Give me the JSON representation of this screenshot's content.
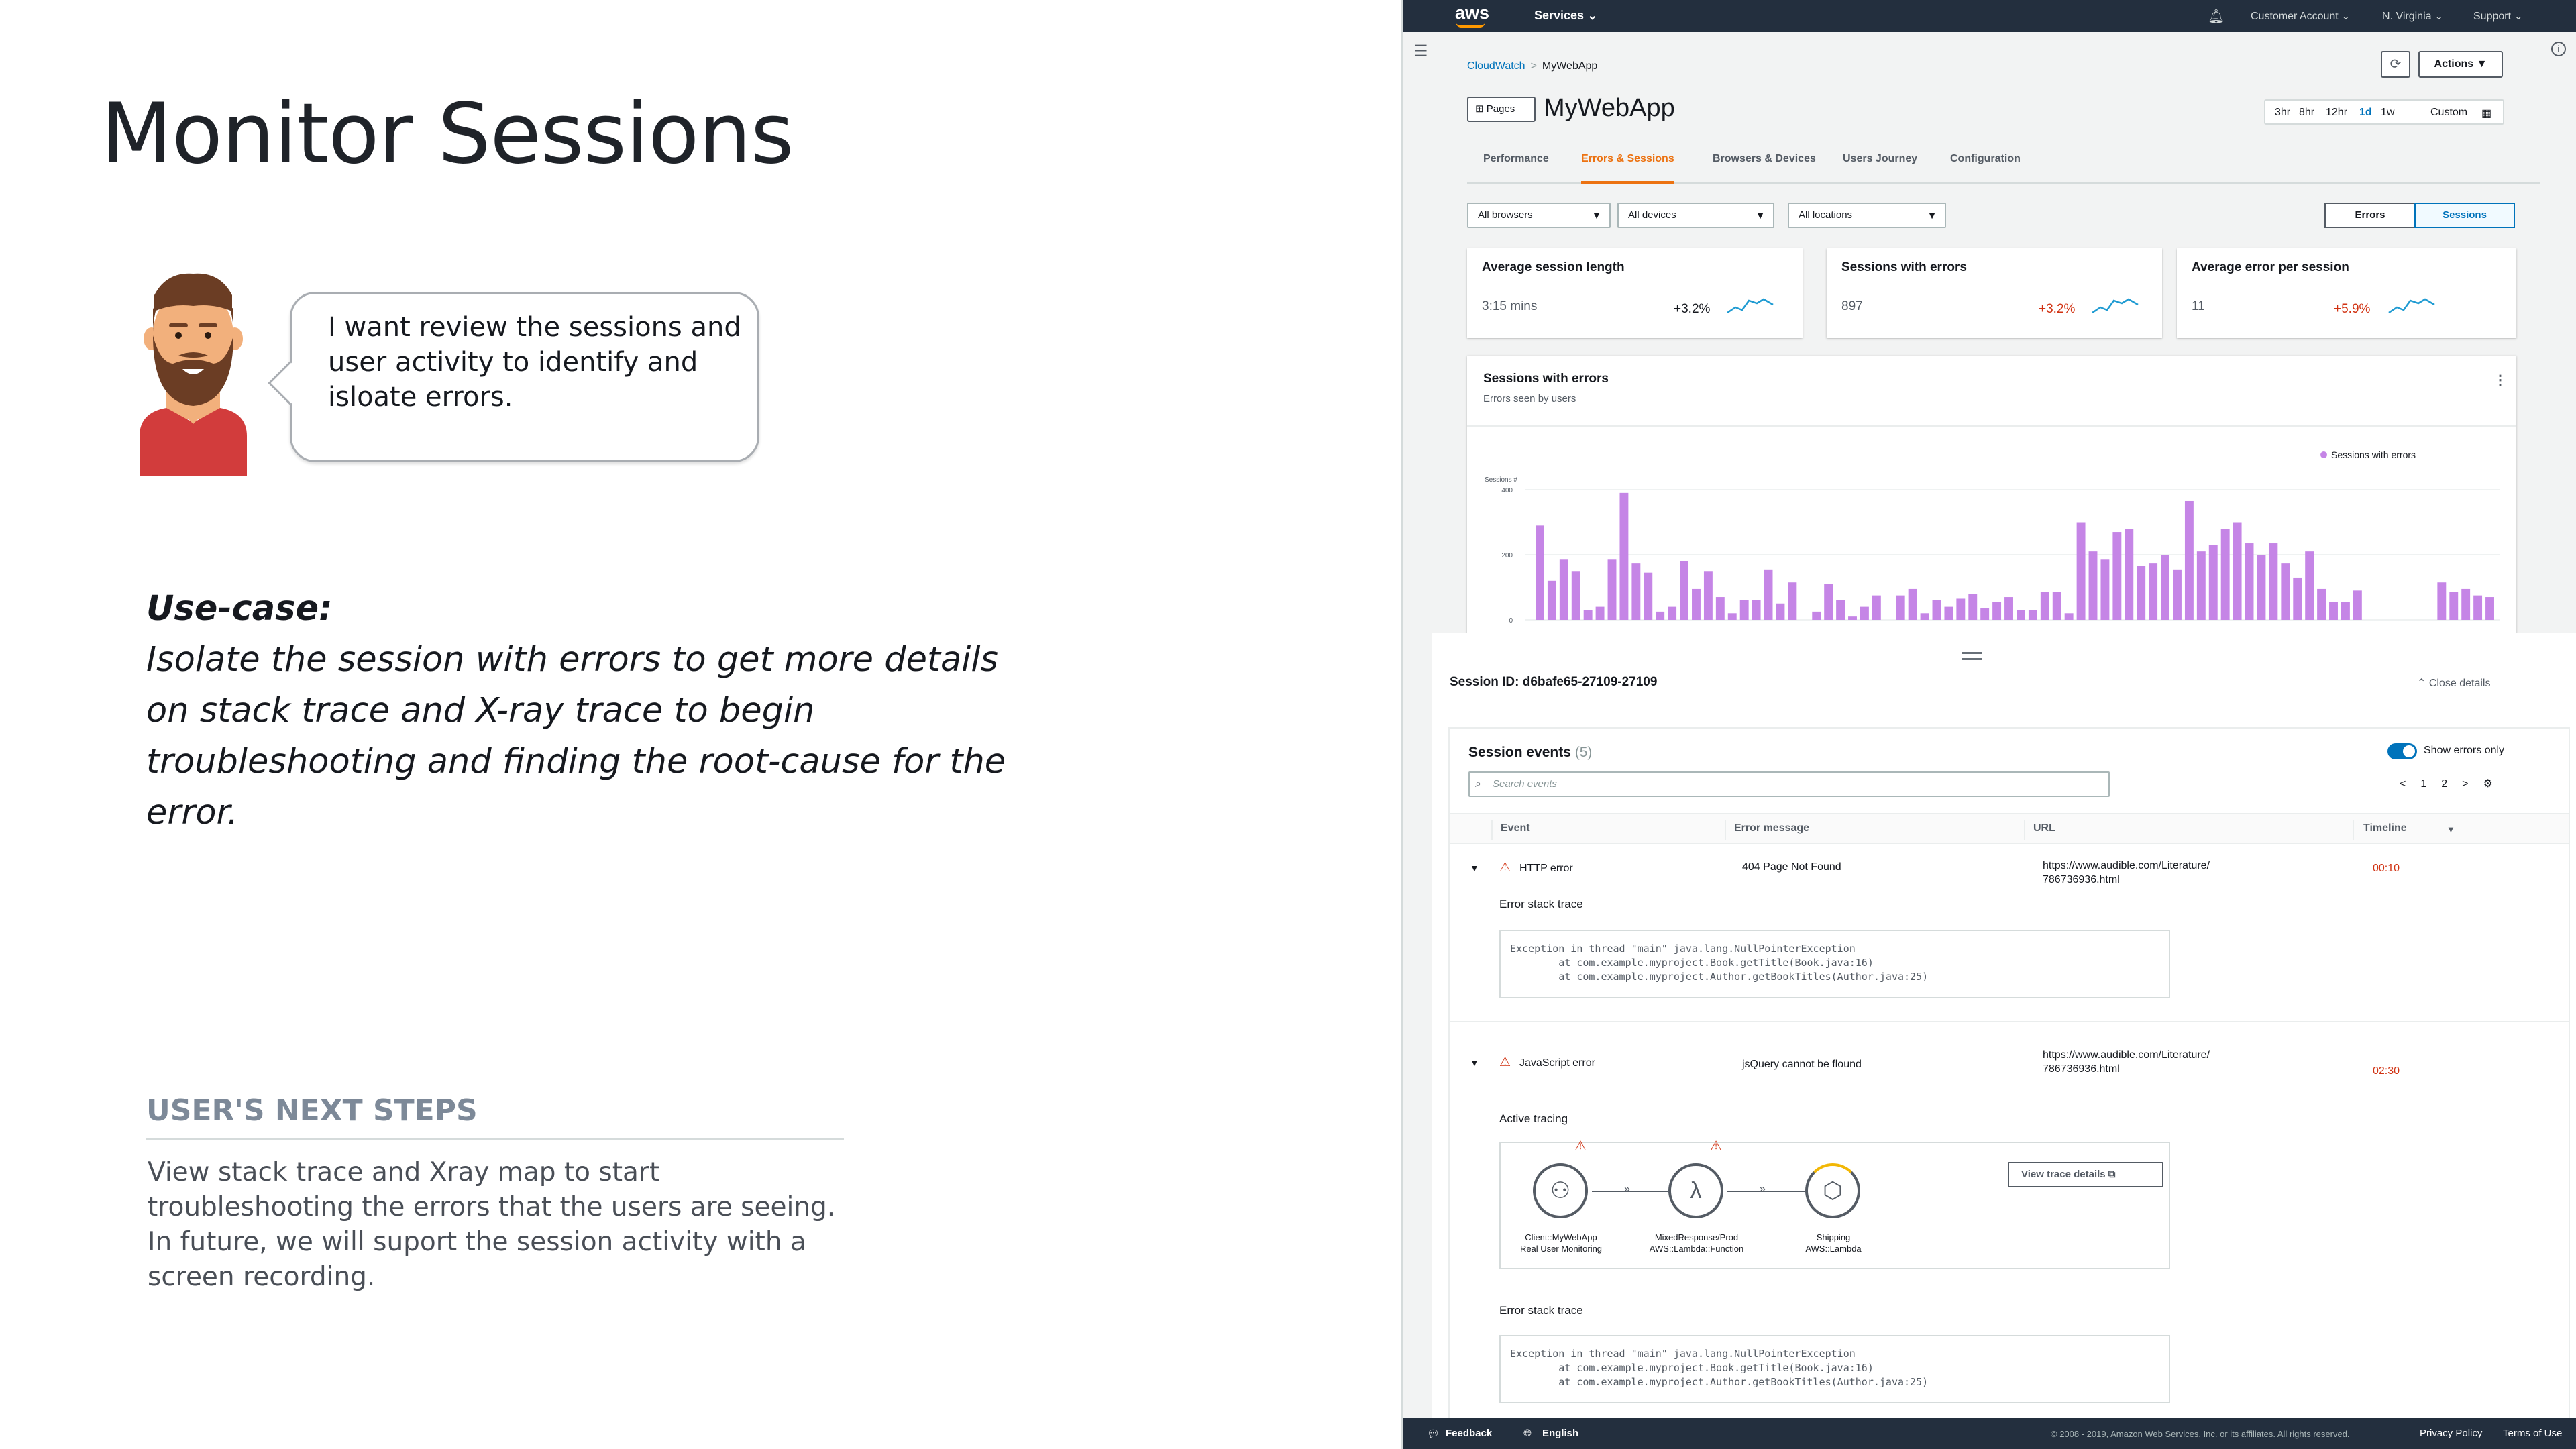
{
  "slide": {
    "title": "Monitor Sessions",
    "speech": "I want review the sessions and user activity to identify and isloate errors.",
    "usecase_head": "Use-case:",
    "usecase_body": "Isolate the session with errors to get more details on stack trace and X-ray trace to begin troubleshooting and finding the root-cause for the error.",
    "next_steps_title": "USER'S NEXT STEPS",
    "next_steps_body": "View stack trace and Xray map to start troubleshooting the errors that the users are seeing. In future, we will suport the session activity with a screen recording."
  },
  "topnav": {
    "logo": "aws",
    "services": "Services ⌄",
    "account": "Customer Account ⌄",
    "region": "N. Virginia ⌄",
    "support": "Support ⌄"
  },
  "breadcrumb": {
    "root": "CloudWatch",
    "separator": ">",
    "current": "MyWebApp"
  },
  "header": {
    "actions_label": "Actions ▼",
    "pages_label": "Pages",
    "app_title": "MyWebApp",
    "time_options": [
      "3hr",
      "8hr",
      "12hr",
      "1d",
      "1w",
      "Custom"
    ],
    "time_selected": "1d"
  },
  "tabs": [
    "Performance",
    "Errors & Sessions",
    "Browsers & Devices",
    "Users Journey",
    "Configuration"
  ],
  "tab_active": "Errors & Sessions",
  "filters": {
    "browsers": "All browsers",
    "devices": "All devices",
    "locations": "All locations",
    "segments": [
      "Errors",
      "Sessions"
    ],
    "segment_selected": "Sessions"
  },
  "kpis": [
    {
      "title": "Average session length",
      "value": "3:15 mins",
      "delta": "+3.2%",
      "delta_color": "#16191f"
    },
    {
      "title": "Sessions with errors",
      "value": "897",
      "delta": "+3.2%",
      "delta_color": "#d13212"
    },
    {
      "title": "Average error per session",
      "value": "11",
      "delta": "+5.9%",
      "delta_color": "#d13212"
    }
  ],
  "chart_panel": {
    "title": "Sessions with errors",
    "subtitle": "Errors seen by users",
    "menu": "⋮"
  },
  "chart_data": {
    "type": "bar",
    "ylabel": "Sessions #",
    "yticks": [
      0,
      200,
      400
    ],
    "ylim": [
      0,
      400
    ],
    "legend": "Sessions with errors",
    "legend_position": "top-right",
    "bar_color": "#c585e6",
    "values": [
      290,
      120,
      185,
      150,
      30,
      40,
      185,
      390,
      175,
      145,
      25,
      40,
      180,
      95,
      150,
      70,
      20,
      60,
      60,
      155,
      50,
      115,
      0,
      25,
      110,
      60,
      10,
      40,
      75,
      0,
      75,
      95,
      20,
      60,
      40,
      65,
      80,
      35,
      55,
      70,
      30,
      30,
      85,
      85,
      20,
      300,
      210,
      185,
      270,
      280,
      165,
      175,
      200,
      155,
      365,
      210,
      230,
      280,
      300,
      235,
      200,
      235,
      175,
      130,
      210,
      95,
      55,
      55,
      90,
      0,
      0,
      0,
      0,
      0,
      0,
      115,
      85,
      95,
      75,
      70
    ]
  },
  "detail": {
    "session_label": "Session ID: d6bafe65-27109-27109",
    "close_label": "⌃ Close details",
    "events_title": "Session events",
    "events_count": "(5)",
    "toggle_label": "Show errors only",
    "search_placeholder": "Search events",
    "pager_prev": "<",
    "pager_pages": [
      "1",
      "2"
    ],
    "pager_next": ">",
    "pager_settings": "⚙",
    "columns": [
      "Event",
      "Error message",
      "URL",
      "Timeline"
    ]
  },
  "events": [
    {
      "name": "HTTP error",
      "message": "404 Page Not Found",
      "url_line1": "https://www.audible.com/Literature/",
      "url_line2": "786736936.html",
      "time": "00:10",
      "section_label": "Error stack trace",
      "trace": "Exception in thread \"main\" java.lang.NullPointerException\n        at com.example.myproject.Book.getTitle(Book.java:16)\n        at com.example.myproject.Author.getBookTitles(Author.java:25)"
    },
    {
      "name": "JavaScript error",
      "message": "jsQuery cannot be flound",
      "url_line1": "https://www.audible.com/Literature/",
      "url_line2": "786736936.html",
      "time": "02:30",
      "section_label": "Active tracing",
      "view_trace_label": "View trace details ⧉",
      "nodes": [
        {
          "label1": "Client::MyWebApp",
          "label2": "Real User Monitoring",
          "icon": "user-monitoring-icon",
          "glyph": "⚇"
        },
        {
          "label1": "MixedResponse/Prod",
          "label2": "AWS::Lambda::Function",
          "icon": "lambda-icon",
          "glyph": "λ"
        },
        {
          "label1": "Shipping",
          "label2": "AWS::Lambda",
          "icon": "hexagon-service-icon",
          "glyph": "⬡"
        }
      ],
      "section2_label": "Error stack trace",
      "trace": "Exception in thread \"main\" java.lang.NullPointerException\n        at com.example.myproject.Book.getTitle(Book.java:16)\n        at com.example.myproject.Author.getBookTitles(Author.java:25)"
    }
  ],
  "footer": {
    "feedback": "Feedback",
    "language": "English",
    "copyright": "© 2008 - 2019, Amazon Web Services, Inc. or its affiliates. All rights reserved.",
    "privacy": "Privacy Policy",
    "terms": "Terms of Use"
  }
}
